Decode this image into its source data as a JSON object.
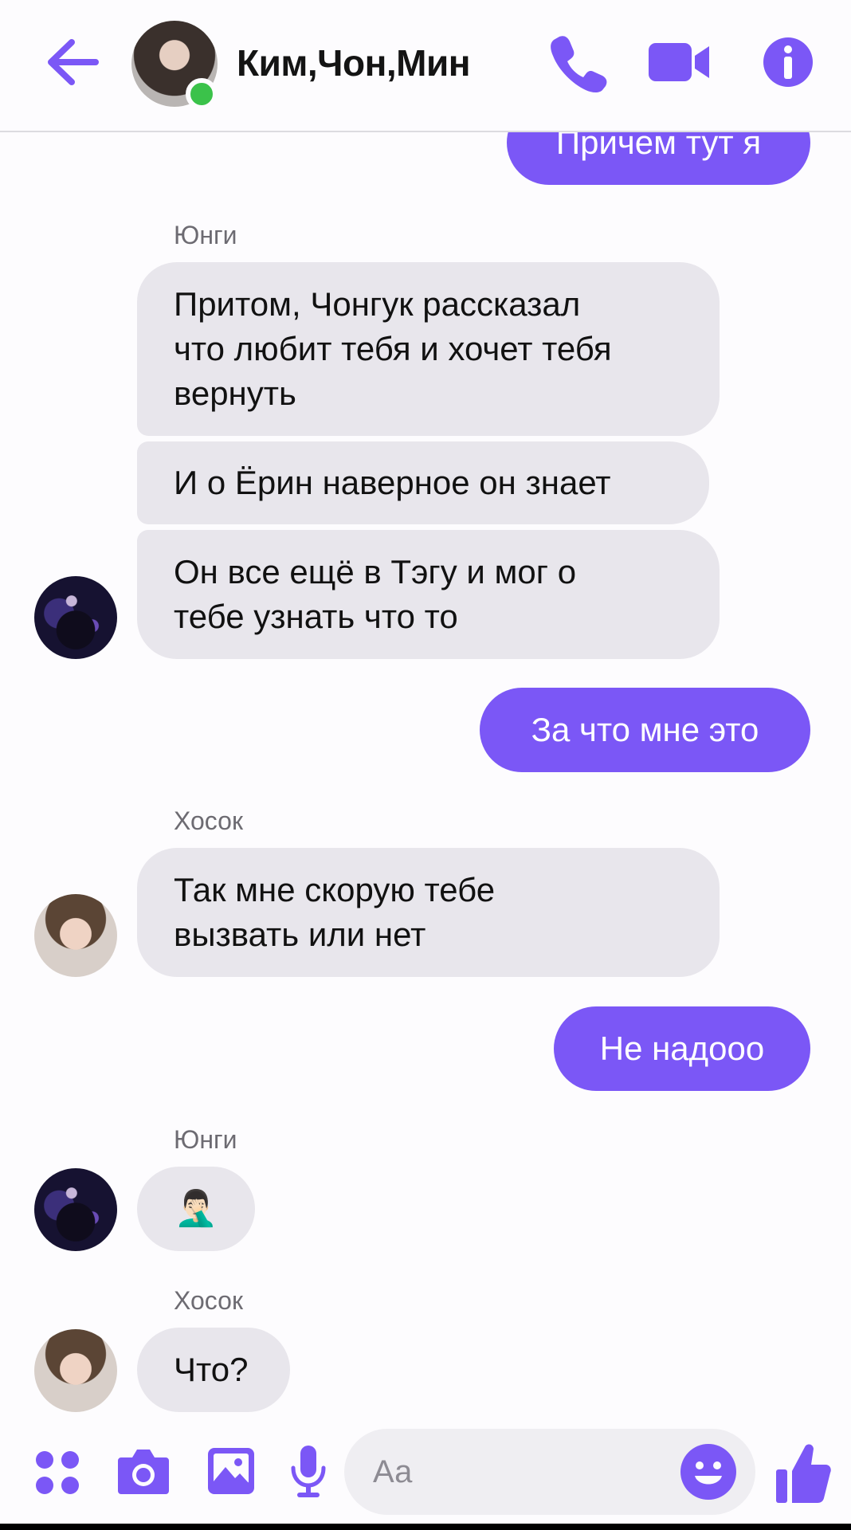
{
  "header": {
    "title": "Ким,Чон,Мин",
    "icons": {
      "back": "arrow-left-icon",
      "call": "phone-icon",
      "video": "video-camera-icon",
      "info": "info-icon"
    },
    "online": true
  },
  "messages": [
    {
      "type": "outgoing",
      "text": "Причем тут я"
    },
    {
      "type": "sender",
      "text": "Юнги"
    },
    {
      "type": "incoming",
      "lines": [
        "Притом, Чонгук рассказал",
        "что любит тебя и хочет тебя",
        "вернуть"
      ]
    },
    {
      "type": "incoming",
      "lines": [
        "И о Ёрин наверное он знает"
      ]
    },
    {
      "type": "incoming",
      "lines": [
        "Он все ещё в Тэгу и мог о",
        "тебе узнать что то"
      ]
    },
    {
      "type": "outgoing",
      "text": "За что мне это"
    },
    {
      "type": "sender",
      "text": "Хосок"
    },
    {
      "type": "incoming",
      "lines": [
        "Так мне скорую тебе",
        "вызвать или нет"
      ]
    },
    {
      "type": "outgoing",
      "text": "Не надооо"
    },
    {
      "type": "sender",
      "text": "Юнги"
    },
    {
      "type": "incoming",
      "emoji": "🤦🏻‍♂️"
    },
    {
      "type": "sender",
      "text": "Хосок"
    },
    {
      "type": "incoming",
      "lines": [
        "Что?"
      ]
    }
  ],
  "composer": {
    "placeholder": "Аа",
    "icons": {
      "apps": "apps-grid-icon",
      "camera": "camera-icon",
      "gallery": "image-icon",
      "mic": "microphone-icon",
      "emoji": "smiley-icon",
      "like": "thumbs-up-icon"
    }
  },
  "colors": {
    "accent": "#7b57f6",
    "incoming_bubble": "#e8e6ec",
    "online": "#3bc24a"
  }
}
